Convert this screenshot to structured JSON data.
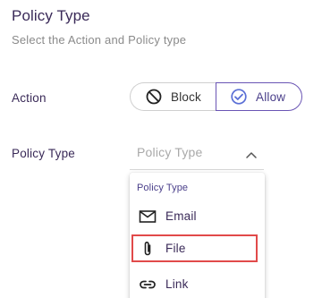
{
  "header": {
    "title": "Policy Type",
    "subtitle": "Select the Action and Policy type"
  },
  "action": {
    "label": "Action",
    "options": [
      {
        "label": "Block",
        "icon": "block-icon",
        "selected": false
      },
      {
        "label": "Allow",
        "icon": "check-circle-icon",
        "selected": true
      }
    ]
  },
  "policy_type": {
    "label": "Policy Type",
    "placeholder": "Policy Type",
    "dropdown_open": true,
    "dropdown": {
      "header": "Policy Type",
      "options": [
        {
          "label": "Email",
          "icon": "mail-icon"
        },
        {
          "label": "File",
          "icon": "paperclip-icon",
          "highlighted": true
        },
        {
          "label": "Link",
          "icon": "link-icon"
        }
      ]
    }
  },
  "colors": {
    "accent": "#4a3f8a",
    "allow_icon": "#5a6fd6",
    "highlight_border": "#e14a4a"
  }
}
